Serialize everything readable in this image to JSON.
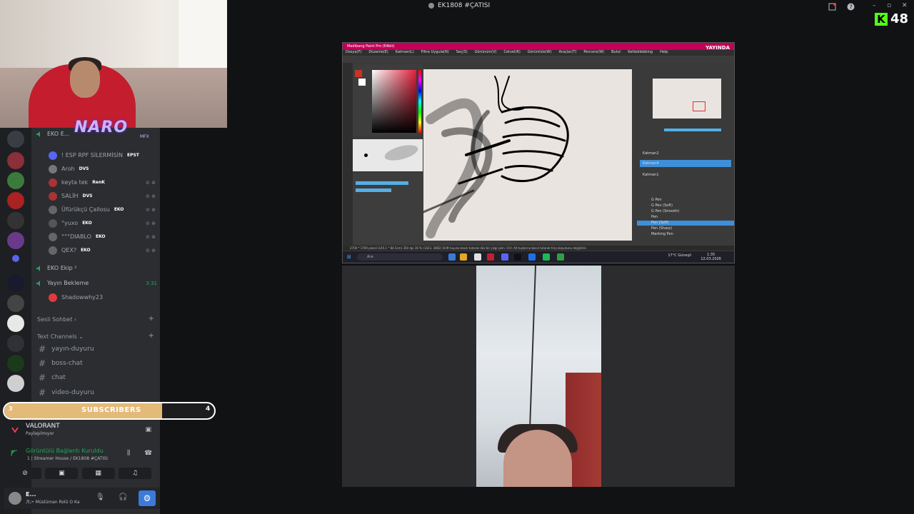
{
  "window": {
    "title": "EK1808 #ÇATISI"
  },
  "kick": {
    "viewers": "48"
  },
  "overlay": {
    "logo_text": "NARO",
    "logo_sub": "MFX"
  },
  "voice": {
    "channels": [
      {
        "name": "EKO E...",
        "users": [
          {
            "name": "! ESP RPF SİLERMİSİN",
            "tag": "EPST",
            "color": "#5865f2"
          },
          {
            "name": "Aroh",
            "tag": "DVS",
            "color": "#777"
          },
          {
            "name": "keyta tek",
            "tag": "RenK",
            "color": "#a33"
          },
          {
            "name": "SALİH",
            "tag": "DVS",
            "color": "#a33"
          },
          {
            "name": "Üfürükçü Çallosu",
            "tag": "EKO",
            "color": "#666"
          },
          {
            "name": "°yuxo",
            "tag": "EKO",
            "color": "#555"
          },
          {
            "name": "°°°DIABLO",
            "tag": "EKO",
            "color": "#666"
          },
          {
            "name": "QEX?",
            "tag": "EKO",
            "color": "#666"
          }
        ]
      },
      {
        "name": "EKO Ekip ²",
        "users": []
      },
      {
        "name": "Yayın Bekleme",
        "time": "3:31",
        "users": [
          {
            "name": "Shadowwhy23",
            "color": "#e03b3b"
          }
        ]
      }
    ]
  },
  "sections": {
    "voice_section": "Sesli Sohbet",
    "text_section": "Text Channels",
    "text_channels": [
      "yayın-duyuru",
      "boss-chat",
      "chat",
      "video-duyuru"
    ]
  },
  "subscribers": {
    "label": "SUBSCRIBERS",
    "current": "3",
    "goal": "4",
    "progress": 0.75,
    "fill_color": "#e3ba78"
  },
  "activity": {
    "game": "VALORANT",
    "status": "Paylaşılmıyor"
  },
  "connection": {
    "status": "Görüntülü Bağlantı Kuruldu",
    "location": "1 | Streamer House / EK1808 #ÇATISI"
  },
  "user": {
    "name": "E...",
    "status": "♬♩• Müslüman Rolü O Ka"
  },
  "csp": {
    "title": "Medibang Paint Pro (64bit)",
    "live_badge": "YAYINDA",
    "menu": [
      "Dosya(F)",
      "Düzenle(E)",
      "Katman(L)",
      "Filtre Uygula(N)",
      "Seç(S)",
      "Görünüm(V)",
      "Cetvel(R)",
      "Görüntüle(W)",
      "Araçlar(T)",
      "Pencere(W)",
      "Bulut",
      "Ketteblebbing",
      "Help"
    ],
    "layers": [
      "Katman2",
      "Katman4",
      "Katman1"
    ],
    "brushes": [
      "G Pen",
      "G Pen (Soft)",
      "G Pen (Smooth)",
      "Pen",
      "Pen (Soft)",
      "Pen (Sharp)",
      "Marking Pen"
    ],
    "status_text": "2700 * 1700 piksel (145.1 * 84.5cm) 350 dpi 16 % (1423, 3802) Shift tuşuna basılı tutarak düz bir çizgi çizin. Ctrl, Alt tuşlarına basılı tutarak fırça boyutunu değiştirin",
    "taskbar_search": "Ara",
    "weather": "17°C Güneşli",
    "clock_time": "1:35",
    "clock_date": "12.03.2026"
  }
}
